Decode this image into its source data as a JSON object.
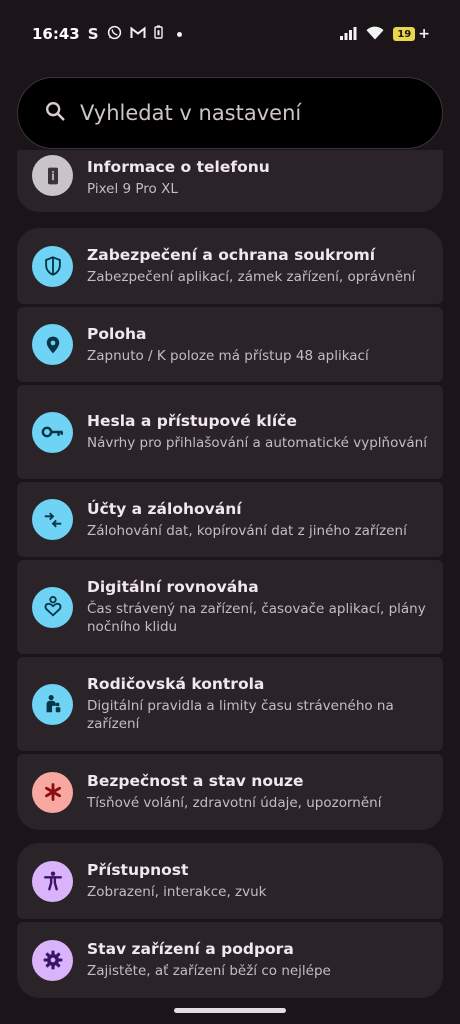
{
  "status_bar": {
    "time": "16:43",
    "app_icons": [
      "S",
      "whatsapp-icon",
      "gmail-icon",
      "battery-saver-icon"
    ],
    "battery_level": "19"
  },
  "search": {
    "placeholder": "Vyhledat v nastavení"
  },
  "groups": [
    {
      "items": [
        {
          "title": "Informace o telefonu",
          "subtitle": "Pixel 9 Pro XL",
          "icon": "phone-info-icon",
          "icon_bg": "#c9c4c8"
        }
      ]
    },
    {
      "items": [
        {
          "title": "Zabezpečení a ochrana soukromí",
          "subtitle": "Zabezpečení aplikací, zámek zařízení, oprávnění",
          "icon": "shield-icon",
          "icon_bg": "#6fd3f5"
        },
        {
          "title": "Poloha",
          "subtitle": "Zapnuto / K poloze má přístup 48 aplikací",
          "icon": "location-pin-icon",
          "icon_bg": "#6fd3f5"
        },
        {
          "title": "Hesla a přístupové klíče",
          "subtitle": "Návrhy pro přihlašování a automatické vyplňování",
          "icon": "key-icon",
          "icon_bg": "#6fd3f5"
        },
        {
          "title": "Účty a zálohování",
          "subtitle": "Zálohování dat, kopírování dat z jiného zařízení",
          "icon": "sync-arrows-icon",
          "icon_bg": "#6fd3f5"
        },
        {
          "title": "Digitální rovnováha",
          "subtitle": "Čas strávený na zařízení, časovače aplikací, plány nočního klidu",
          "icon": "wellbeing-icon",
          "icon_bg": "#6fd3f5"
        },
        {
          "title": "Rodičovská kontrola",
          "subtitle": "Digitální pravidla a limity času stráveného na zařízení",
          "icon": "parental-icon",
          "icon_bg": "#6fd3f5"
        },
        {
          "title": "Bezpečnost a stav nouze",
          "subtitle": "Tísňové volání, zdravotní údaje, upozornění",
          "icon": "emergency-asterisk-icon",
          "icon_bg": "#f7a8a0"
        }
      ]
    },
    {
      "items": [
        {
          "title": "Přístupnost",
          "subtitle": "Zobrazení, interakce, zvuk",
          "icon": "accessibility-icon",
          "icon_bg": "#d9b4fb"
        },
        {
          "title": "Stav zařízení a podpora",
          "subtitle": "Zajistěte, ať zařízení běží co nejlépe",
          "icon": "gear-icon",
          "icon_bg": "#d9b4fb"
        }
      ]
    }
  ]
}
